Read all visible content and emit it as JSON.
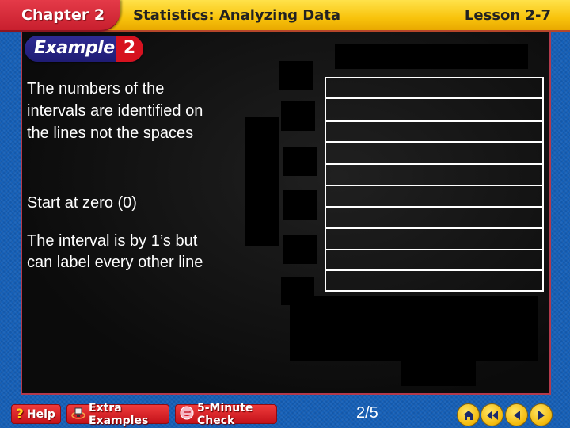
{
  "header": {
    "chapter": "Chapter 2",
    "title": "Statistics: Analyzing Data",
    "lesson": "Lesson 2-7"
  },
  "example": {
    "word": "Example",
    "number": "2"
  },
  "notes": [
    "The numbers of the intervals are identified on the lines not the spaces",
    "Start at zero (0)",
    "The interval is by 1’s but can label every other line"
  ],
  "footer": {
    "help_label": "Help",
    "extra_examples_label": "Extra Examples",
    "five_minute_check_label": "5-Minute Check",
    "page_indicator": "2/5",
    "nav_icons": [
      "home-icon",
      "first-slide-icon",
      "previous-slide-icon",
      "next-slide-icon"
    ]
  },
  "colors": {
    "header_red": "#c81f2e",
    "header_yellow": "#f8c30c",
    "background_blue": "#1560b8",
    "example_blue": "#1f1c74",
    "example_red": "#d6121f"
  }
}
